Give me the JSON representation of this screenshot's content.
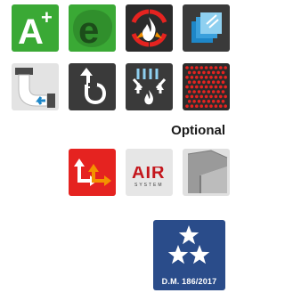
{
  "tiles_row1": [
    {
      "icon": "energy-class-a-plus-icon",
      "text_main": "A",
      "text_sup": "+",
      "bg": "#3aa935"
    },
    {
      "icon": "eco-leaf-e-icon",
      "text": "e",
      "bg": "#3aa935"
    },
    {
      "icon": "flame-heat-recovery-icon",
      "bg": "#2b2b2b"
    },
    {
      "icon": "layered-glass-panels-icon",
      "bg": "#3a3a3a"
    }
  ],
  "tiles_row2": [
    {
      "icon": "pipe-elbow-icon",
      "bg": "#e3e3e3"
    },
    {
      "icon": "pipe-rotation-icon",
      "bg": "#3a3a3a"
    },
    {
      "icon": "airflow-convection-icon",
      "bg": "#3a3a3a"
    },
    {
      "icon": "red-dot-grille-icon",
      "bg": "#2b2b2b"
    }
  ],
  "optional_label": "Optional",
  "tiles_optional": [
    {
      "icon": "double-arrow-flow-icon",
      "bg": "#e52320"
    },
    {
      "icon": "air-system-logo-icon",
      "text": "AIR",
      "subtext": "SYSTEM",
      "bg": "#e6e6e6"
    },
    {
      "icon": "corner-profile-icon",
      "bg": "#e0e0e0"
    }
  ],
  "badge": {
    "icon": "three-stars-icon",
    "text": "D.M. 186/2017",
    "bg": "#2a4c8a"
  }
}
